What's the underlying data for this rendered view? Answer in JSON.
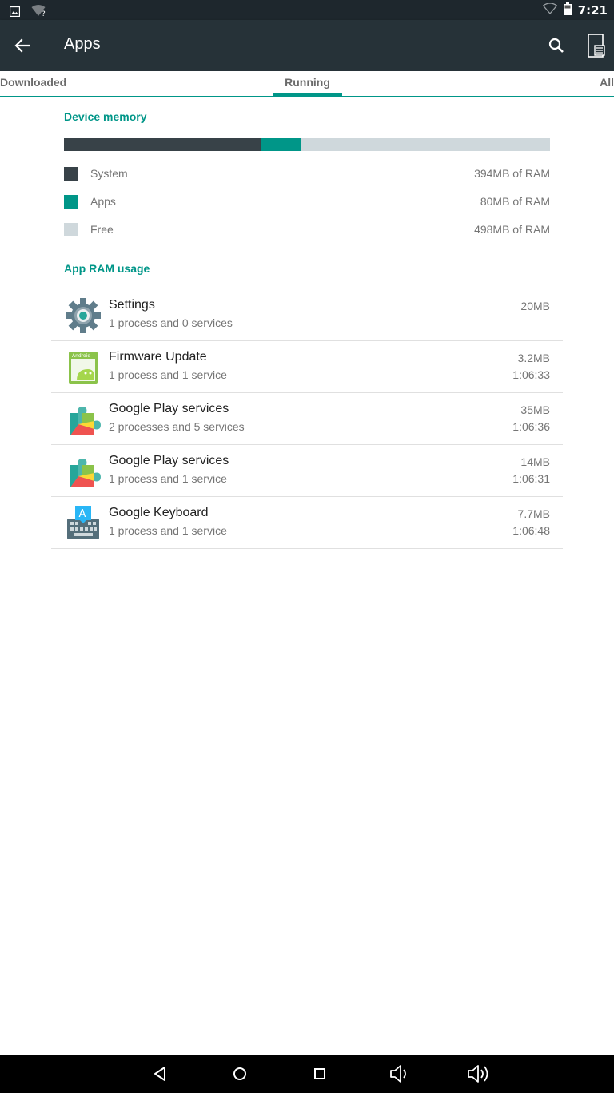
{
  "status_bar": {
    "time": "7:21",
    "icons": [
      "image-icon",
      "wifi-unknown-icon",
      "wifi-icon",
      "battery-icon"
    ]
  },
  "app_bar": {
    "title": "Apps",
    "icons": [
      "back-arrow-icon",
      "search-icon",
      "storage-icon"
    ]
  },
  "tabs": {
    "downloaded": "Downloaded",
    "running": "Running",
    "all": "All",
    "selected": "Running"
  },
  "device_memory": {
    "header": "Device memory",
    "segments": [
      {
        "label": "System",
        "value": "394MB of RAM",
        "mb": 394,
        "color": "#384248"
      },
      {
        "label": "Apps",
        "value": "80MB of RAM",
        "mb": 80,
        "color": "#009688"
      },
      {
        "label": "Free",
        "value": "498MB of RAM",
        "mb": 498,
        "color": "#cfd8dc"
      }
    ]
  },
  "app_ram": {
    "header": "App RAM usage",
    "items": [
      {
        "name": "Settings",
        "desc": "1 process and 0 services",
        "size": "20MB",
        "time": "",
        "icon": "settings-gear-icon"
      },
      {
        "name": "Firmware Update",
        "desc": "1 process and 1 service",
        "size": "3.2MB",
        "time": "1:06:33",
        "icon": "android-firmware-icon"
      },
      {
        "name": "Google Play services",
        "desc": "2 processes and 5 services",
        "size": "35MB",
        "time": "1:06:36",
        "icon": "puzzle-piece-icon"
      },
      {
        "name": "Google Play services",
        "desc": "1 process and 1 service",
        "size": "14MB",
        "time": "1:06:31",
        "icon": "puzzle-piece-icon"
      },
      {
        "name": "Google Keyboard",
        "desc": "1 process and 1 service",
        "size": "7.7MB",
        "time": "1:06:48",
        "icon": "keyboard-icon"
      }
    ]
  },
  "nav_bar": {
    "icons": [
      "back-triangle-icon",
      "home-circle-icon",
      "recents-square-icon",
      "volume-down-icon",
      "volume-up-icon"
    ]
  },
  "colors": {
    "accent": "#009688",
    "app_bar": "#263238",
    "status_bar": "#1e272d"
  }
}
